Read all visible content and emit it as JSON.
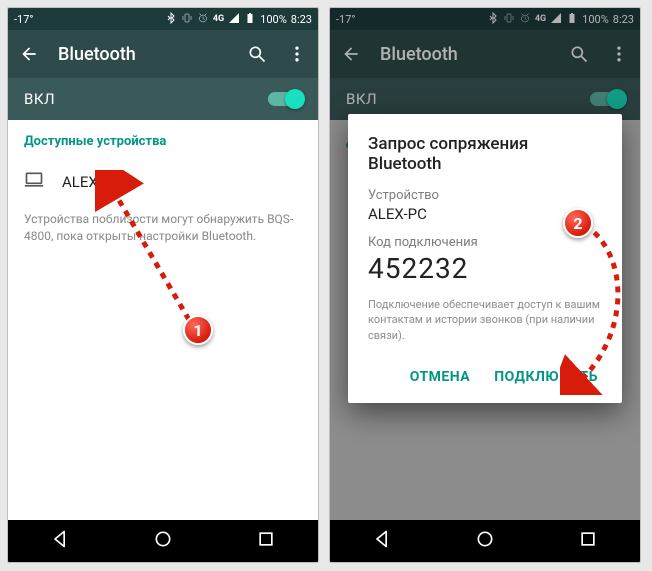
{
  "statusbar": {
    "temp": "-17°",
    "battery": "100%",
    "time": "8:23"
  },
  "appbar": {
    "title": "Bluetooth"
  },
  "toggle": {
    "label": "ВКЛ"
  },
  "list": {
    "section_header": "Доступные устройства",
    "device_name": "ALEX-PC",
    "hint": "Устройства поблизости могут обнаружить BQS-4800, пока открыты настройки Bluetooth."
  },
  "dialog": {
    "title": "Запрос сопряжения Bluetooth",
    "device_label": "Устройство",
    "device_name": "ALEX-PC",
    "code_label": "Код подключения",
    "code": "452232",
    "hint": "Подключение обеспечивает доступ к вашим контактам и истории звонков (при наличии связи).",
    "cancel": "ОТМЕНА",
    "connect": "ПОДКЛЮЧИТЬ"
  },
  "annotations": {
    "step1": "1",
    "step2": "2"
  }
}
